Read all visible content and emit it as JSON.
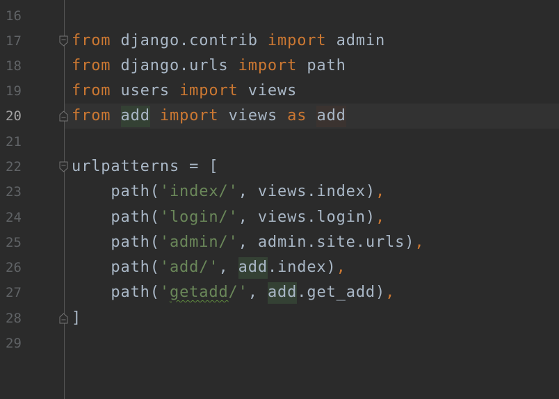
{
  "editor": {
    "current_line": "20",
    "colors": {
      "background": "#2b2b2b",
      "keyword": "#cc7832",
      "string": "#6a8759",
      "identifier": "#a9b7c6",
      "line_number": "#606366",
      "usage_highlight": "#344134"
    },
    "lines": [
      {
        "number": "16"
      },
      {
        "number": "17",
        "t": [
          "from",
          " django.contrib ",
          "import",
          " admin"
        ]
      },
      {
        "number": "18",
        "t": [
          "from",
          " django.urls ",
          "import",
          " path"
        ]
      },
      {
        "number": "19",
        "t": [
          "from",
          " users ",
          "import",
          " views"
        ]
      },
      {
        "number": "20",
        "t": [
          "from",
          " ",
          "add",
          " ",
          "import",
          " views ",
          "as",
          " ",
          "add"
        ]
      },
      {
        "number": "21"
      },
      {
        "number": "22",
        "t": [
          "urlpatterns = ["
        ]
      },
      {
        "number": "23",
        "t": [
          "    path(",
          "'index/'",
          ", views.index)",
          ","
        ]
      },
      {
        "number": "24",
        "t": [
          "    path(",
          "'login/'",
          ", views.login)",
          ","
        ]
      },
      {
        "number": "25",
        "t": [
          "    path(",
          "'admin/'",
          ", admin.site.urls)",
          ","
        ]
      },
      {
        "number": "26",
        "t": [
          "    path(",
          "'add/'",
          ", ",
          "add",
          ".index)",
          ","
        ]
      },
      {
        "number": "27",
        "t": [
          "    path(",
          "'",
          "getadd",
          "/'",
          ", ",
          "add",
          ".get_add)",
          ","
        ]
      },
      {
        "number": "28",
        "t": [
          "]"
        ]
      },
      {
        "number": "29"
      }
    ]
  }
}
